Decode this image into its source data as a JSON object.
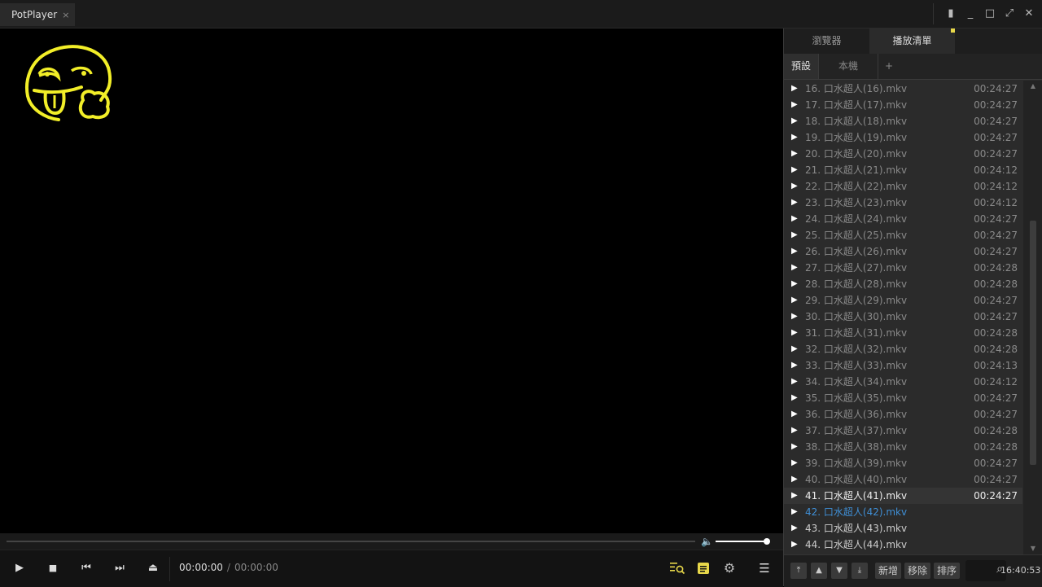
{
  "app": {
    "title": "PotPlayer",
    "close_tab": "×"
  },
  "window": {
    "pin": "▮",
    "minimize": "_",
    "maximize": "□",
    "fullscreen": "⤢",
    "close": "✕"
  },
  "controls": {
    "current_time": "00:00:00",
    "separator": "/",
    "duration": "00:00:00",
    "play_icon": "▶",
    "stop_icon": "■",
    "prev_icon": "⏮",
    "next_icon": "⏭",
    "eject_icon": "⏏",
    "menu_icon": "☰",
    "settings_icon": "⚙",
    "seek_position": 0,
    "volume_level": 1.0
  },
  "panel": {
    "tabs": [
      "瀏覽器",
      "播放清單"
    ],
    "active_tab": "播放清單",
    "subtabs": [
      "預設",
      "本機",
      "+"
    ],
    "active_subtab": "預設",
    "playlist": [
      {
        "label": "16. 口水超人(16).mkv",
        "duration": "00:24:27"
      },
      {
        "label": "17. 口水超人(17).mkv",
        "duration": "00:24:27"
      },
      {
        "label": "18. 口水超人(18).mkv",
        "duration": "00:24:27"
      },
      {
        "label": "19. 口水超人(19).mkv",
        "duration": "00:24:27"
      },
      {
        "label": "20. 口水超人(20).mkv",
        "duration": "00:24:27"
      },
      {
        "label": "21. 口水超人(21).mkv",
        "duration": "00:24:12"
      },
      {
        "label": "22. 口水超人(22).mkv",
        "duration": "00:24:12"
      },
      {
        "label": "23. 口水超人(23).mkv",
        "duration": "00:24:12"
      },
      {
        "label": "24. 口水超人(24).mkv",
        "duration": "00:24:27"
      },
      {
        "label": "25. 口水超人(25).mkv",
        "duration": "00:24:27"
      },
      {
        "label": "26. 口水超人(26).mkv",
        "duration": "00:24:27"
      },
      {
        "label": "27. 口水超人(27).mkv",
        "duration": "00:24:28"
      },
      {
        "label": "28. 口水超人(28).mkv",
        "duration": "00:24:28"
      },
      {
        "label": "29. 口水超人(29).mkv",
        "duration": "00:24:27"
      },
      {
        "label": "30. 口水超人(30).mkv",
        "duration": "00:24:27"
      },
      {
        "label": "31. 口水超人(31).mkv",
        "duration": "00:24:28"
      },
      {
        "label": "32. 口水超人(32).mkv",
        "duration": "00:24:28"
      },
      {
        "label": "33. 口水超人(33).mkv",
        "duration": "00:24:13"
      },
      {
        "label": "34. 口水超人(34).mkv",
        "duration": "00:24:12"
      },
      {
        "label": "35. 口水超人(35).mkv",
        "duration": "00:24:27"
      },
      {
        "label": "36. 口水超人(36).mkv",
        "duration": "00:24:27"
      },
      {
        "label": "37. 口水超人(37).mkv",
        "duration": "00:24:28"
      },
      {
        "label": "38. 口水超人(38).mkv",
        "duration": "00:24:28"
      },
      {
        "label": "39. 口水超人(39).mkv",
        "duration": "00:24:27"
      },
      {
        "label": "40. 口水超人(40).mkv",
        "duration": "00:24:27"
      },
      {
        "label": "41. 口水超人(41).mkv",
        "duration": "00:24:27",
        "state": "current"
      },
      {
        "label": "42. 口水超人(42).mkv",
        "duration": "",
        "state": "selected"
      },
      {
        "label": "43. 口水超人(43).mkv",
        "duration": "",
        "state": "plain"
      },
      {
        "label": "44. 口水超人(44).mkv",
        "duration": "",
        "state": "plain"
      }
    ],
    "bottom": {
      "add": "新增",
      "remove": "移除",
      "sort": "排序",
      "clock": "16:40:53"
    }
  },
  "colors": {
    "accent": "#e8d84a",
    "selected_text": "#3f8fd6",
    "logo": "#f2ee28"
  }
}
